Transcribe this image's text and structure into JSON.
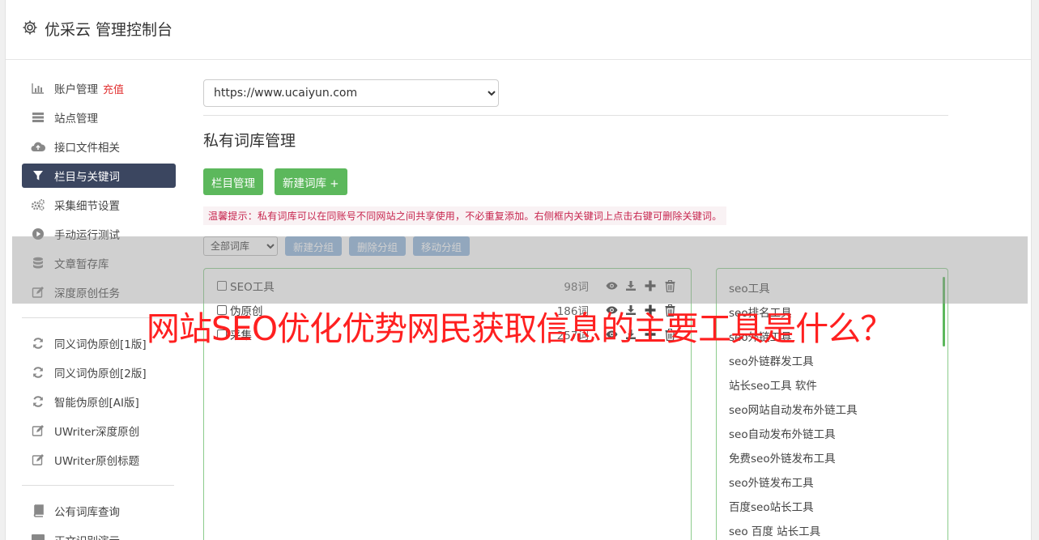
{
  "header": {
    "title": "优采云 管理控制台"
  },
  "sidebar": {
    "items": [
      {
        "label": "账户管理",
        "badge": "充值",
        "icon": "bar-chart-icon"
      },
      {
        "label": "站点管理",
        "icon": "server-icon"
      },
      {
        "label": "接口文件相关",
        "icon": "cloud-upload-icon"
      },
      {
        "label": "栏目与关键词",
        "icon": "filter-icon",
        "active": true
      },
      {
        "label": "采集细节设置",
        "icon": "cogs-icon"
      },
      {
        "label": "手动运行测试",
        "icon": "play-circle-icon"
      },
      {
        "label": "文章暂存库",
        "icon": "database-icon"
      },
      {
        "label": "深度原创任务",
        "icon": "edit-icon"
      }
    ],
    "items2": [
      {
        "label": "同义词伪原创[1版]",
        "icon": "refresh-icon"
      },
      {
        "label": "同义词伪原创[2版]",
        "icon": "refresh-icon"
      },
      {
        "label": "智能伪原创[AI版]",
        "icon": "refresh-icon"
      },
      {
        "label": "UWriter深度原创",
        "icon": "edit-icon"
      },
      {
        "label": "UWriter原创标题",
        "icon": "edit-icon"
      }
    ],
    "items3": [
      {
        "label": "公有词库查询",
        "icon": "book-icon"
      },
      {
        "label": "正文识别演示",
        "icon": "monitor-icon"
      }
    ]
  },
  "main": {
    "site_select": "https://www.ucaiyun.com",
    "page_title": "私有词库管理",
    "btn_columns": "栏目管理",
    "btn_new_lexicon": "新建词库 +",
    "tip": "温馨提示：私有词库可以在同账号不同网站之间共享使用，不必重复添加。右侧框内关键词上点击右键可删除关键词。",
    "group_select": "全部词库",
    "btn_new_group": "新建分组",
    "btn_delete_group": "删除分组",
    "btn_move_group": "移动分组",
    "lexicons": [
      {
        "name": "SEO工具",
        "count": "98词"
      },
      {
        "name": "伪原创",
        "count": "186词"
      },
      {
        "name": "采集",
        "count": "257词"
      }
    ],
    "keywords": [
      "seo工具",
      "seo排名工具",
      "seo外链工具",
      "seo外链群发工具",
      "站长seo工具 软件",
      "seo网站自动发布外链工具",
      "seo自动发布外链工具",
      "免费seo外链发布工具",
      "seo外链发布工具",
      "百度seo站长工具",
      "seo 百度 站长工具"
    ]
  },
  "overlay": {
    "title": "网站SEO优化优势网民获取信息的主要工具是什么？"
  },
  "colors": {
    "accent": "#3b4660",
    "green": "#5cb85c",
    "blue_btn": "#8fb4dd",
    "overlay_text": "#ff2020",
    "tip_text": "#c7254e"
  }
}
